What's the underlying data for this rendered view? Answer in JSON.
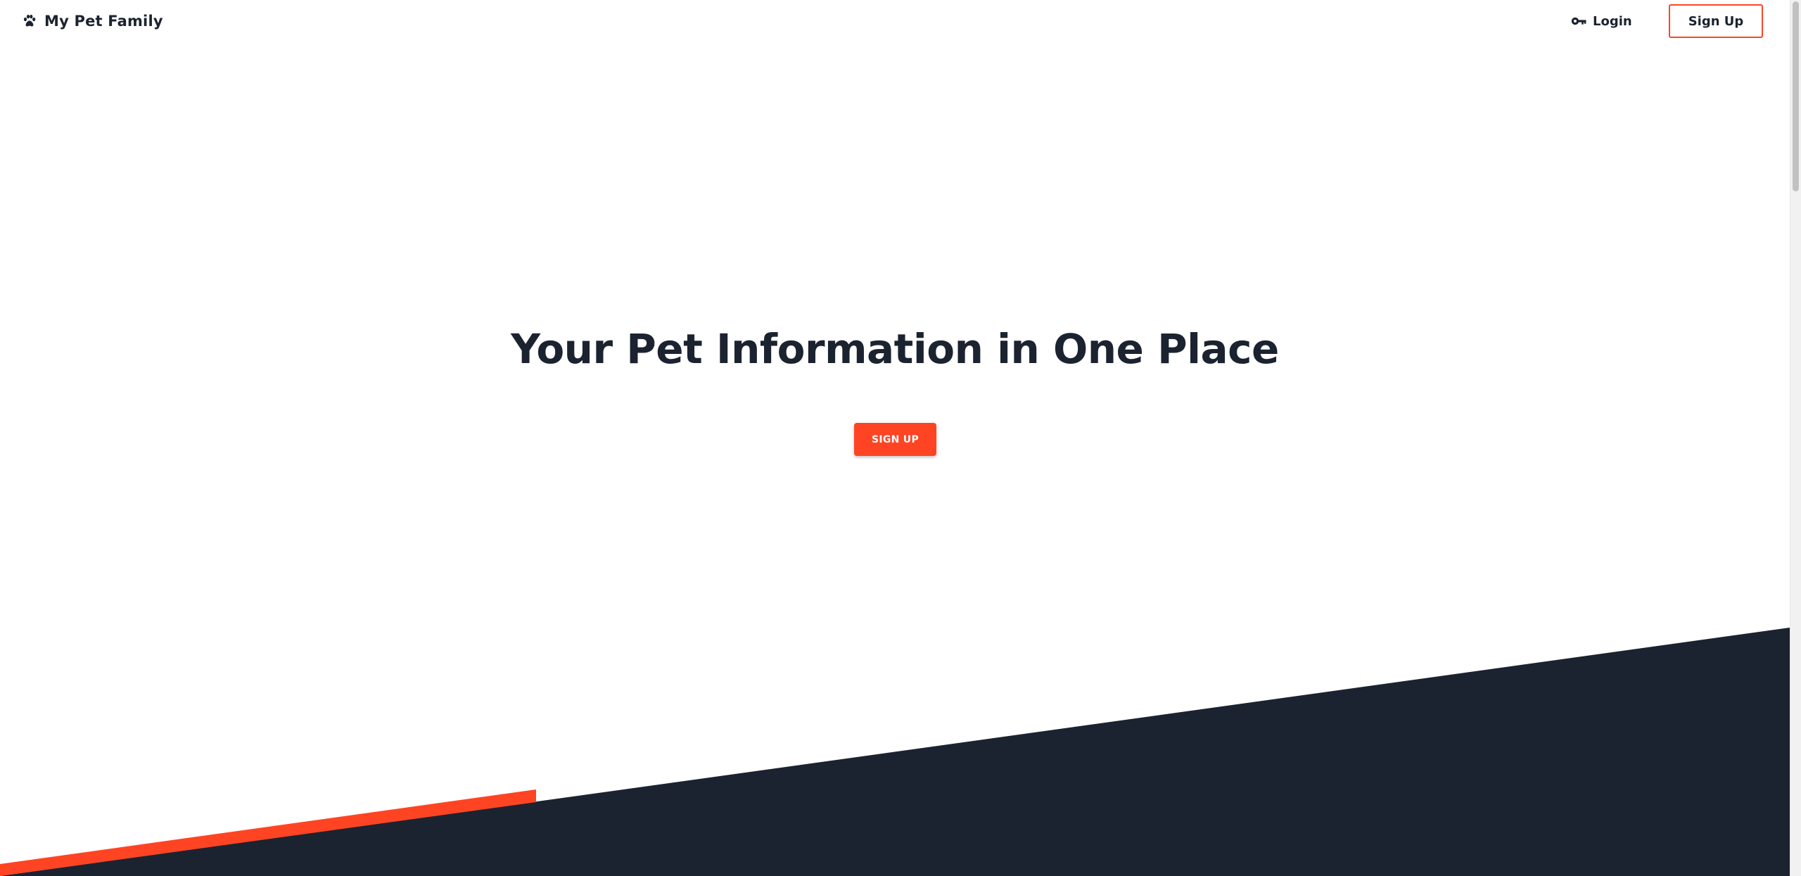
{
  "navbar": {
    "brand": {
      "label": "My Pet Family",
      "icon": "paw-icon"
    },
    "login": {
      "label": "Login",
      "icon": "key-icon"
    },
    "signup_label": "Sign Up"
  },
  "hero": {
    "title": "Your Pet Information in One Place",
    "cta_label": "SIGN UP"
  },
  "colors": {
    "accent": "#ff4423",
    "dark": "#1b2330",
    "background": "#ffffff"
  }
}
